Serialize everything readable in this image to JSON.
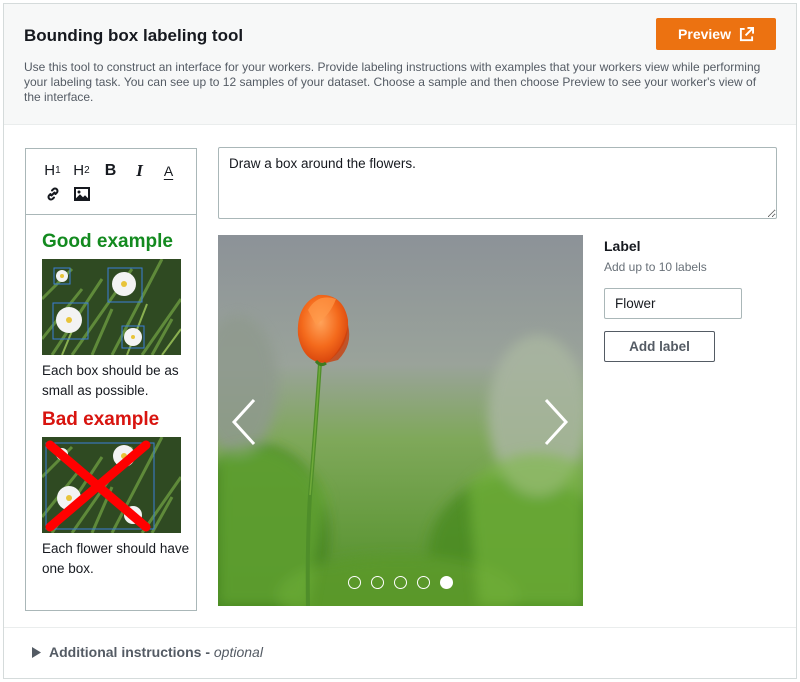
{
  "header": {
    "title": "Bounding box labeling tool",
    "description": "Use this tool to construct an interface for your workers. Provide labeling instructions with examples that your workers view while performing your labeling task. You can see up to 12 samples of your dataset. Choose a sample and then choose Preview to see your worker's view of the interface.",
    "preview_label": "Preview"
  },
  "editor": {
    "toolbar": {
      "h1": "H",
      "h1_sub": "1",
      "h2": "H",
      "h2_sub": "2",
      "bold": "B",
      "italic": "I",
      "color": "A"
    },
    "good_title": "Good example",
    "good_text": "Each box should be as small as possible.",
    "bad_title": "Bad example",
    "bad_text": "Each flower should have one box."
  },
  "task": {
    "instruction": "Draw a box around the flowers."
  },
  "carousel": {
    "dot_count": 5,
    "active_index": 4
  },
  "labels": {
    "title": "Label",
    "hint": "Add up to 10 labels",
    "value": "Flower",
    "add_label": "Add label"
  },
  "footer": {
    "additional_label": "Additional instructions -",
    "optional": "optional"
  },
  "colors": {
    "accent": "#ec7211",
    "good": "#138a1f",
    "bad": "#d8140f"
  },
  "icons": {
    "preview": "external-link-icon",
    "prev": "chevron-left-icon",
    "next": "chevron-right-icon",
    "expand": "caret-right-icon"
  }
}
